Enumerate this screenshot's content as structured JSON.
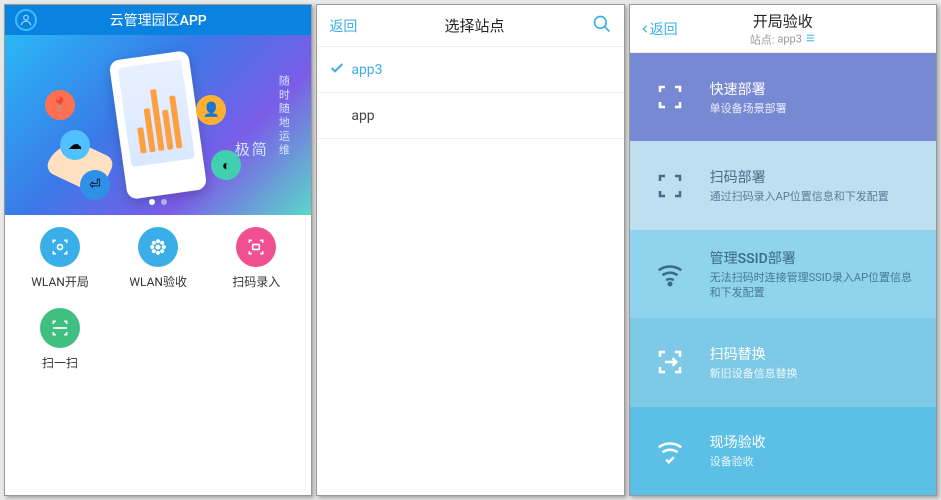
{
  "pane1": {
    "title": "云管理园区APP",
    "slogan_big": "极简",
    "slogan_small": "随\n时\n随\n地\n运\n维",
    "items": [
      {
        "label": "WLAN开局",
        "color": "#3aaee8"
      },
      {
        "label": "WLAN验收",
        "color": "#3aaee8"
      },
      {
        "label": "扫码录入",
        "color": "#f05090"
      },
      {
        "label": "扫一扫",
        "color": "#40c080"
      }
    ]
  },
  "pane2": {
    "back": "返回",
    "title": "选择站点",
    "sites": [
      {
        "name": "app3",
        "selected": true
      },
      {
        "name": "app",
        "selected": false
      }
    ]
  },
  "pane3": {
    "back": "返回",
    "title": "开局验收",
    "subtitle_prefix": "站点:",
    "subtitle_value": "app3",
    "cards": [
      {
        "title": "快速部署",
        "desc": "单设备场景部署"
      },
      {
        "title": "扫码部署",
        "desc": "通过扫码录入AP位置信息和下发配置"
      },
      {
        "title": "管理SSID部署",
        "desc": "无法扫码时连接管理SSID录入AP位置信息和下发配置"
      },
      {
        "title": "扫码替换",
        "desc": "新旧设备信息替换"
      },
      {
        "title": "现场验收",
        "desc": "设备验收"
      }
    ]
  }
}
